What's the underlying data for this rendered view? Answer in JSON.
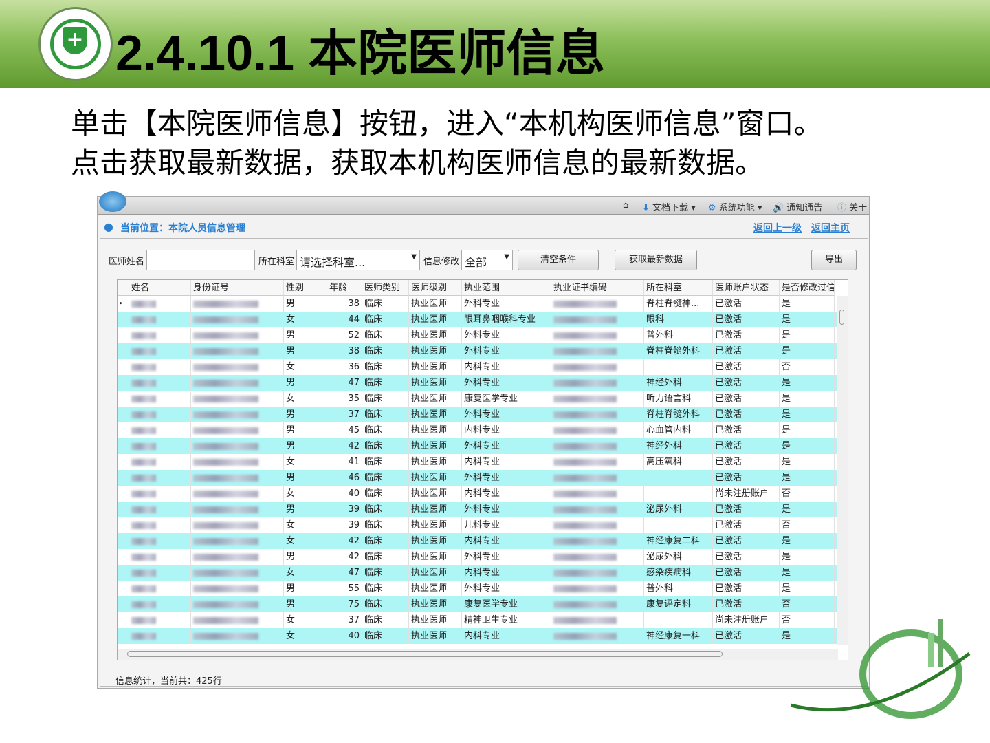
{
  "slide": {
    "title": "2.4.10.1  本院医师信息",
    "line1": "单击【本院医师信息】按钮，进入“本机构医师信息”窗口。",
    "line2": "点击获取最新数据，获取本机构医师信息的最新数据。"
  },
  "toolbar": {
    "download": "文档下载",
    "system": "系统功能",
    "notice": "通知通告",
    "about": "关于"
  },
  "location": {
    "text": "当前位置：本院人员信息管理",
    "back": "返回上一级",
    "home": "返回主页"
  },
  "filters": {
    "name_label": "医师姓名",
    "name_value": "",
    "dept_label": "所在科室",
    "dept_value": "请选择科室...",
    "mod_label": "信息修改",
    "mod_value": "全部",
    "clear": "清空条件",
    "fetch": "获取最新数据",
    "export": "导出"
  },
  "columns": [
    "姓名",
    "身份证号",
    "性别",
    "年龄",
    "医师类别",
    "医师级别",
    "执业范围",
    "执业证书编码",
    "所在科室",
    "医师账户状态",
    "是否修改过信息"
  ],
  "rows": [
    [
      "男",
      "38",
      "临床",
      "执业医师",
      "外科专业",
      "脊柱脊髓神...",
      "已激活",
      "是"
    ],
    [
      "女",
      "44",
      "临床",
      "执业医师",
      "眼耳鼻咽喉科专业",
      "眼科",
      "已激活",
      "是"
    ],
    [
      "男",
      "52",
      "临床",
      "执业医师",
      "外科专业",
      "普外科",
      "已激活",
      "是"
    ],
    [
      "男",
      "38",
      "临床",
      "执业医师",
      "外科专业",
      "脊柱脊髓外科",
      "已激活",
      "是"
    ],
    [
      "女",
      "36",
      "临床",
      "执业医师",
      "内科专业",
      "",
      "已激活",
      "否"
    ],
    [
      "男",
      "47",
      "临床",
      "执业医师",
      "外科专业",
      "神经外科",
      "已激活",
      "是"
    ],
    [
      "女",
      "35",
      "临床",
      "执业医师",
      "康复医学专业",
      "听力语言科",
      "已激活",
      "是"
    ],
    [
      "男",
      "37",
      "临床",
      "执业医师",
      "外科专业",
      "脊柱脊髓外科",
      "已激活",
      "是"
    ],
    [
      "男",
      "45",
      "临床",
      "执业医师",
      "内科专业",
      "心血管内科",
      "已激活",
      "是"
    ],
    [
      "男",
      "42",
      "临床",
      "执业医师",
      "外科专业",
      "神经外科",
      "已激活",
      "是"
    ],
    [
      "女",
      "41",
      "临床",
      "执业医师",
      "内科专业",
      "高压氧科",
      "已激活",
      "是"
    ],
    [
      "男",
      "46",
      "临床",
      "执业医师",
      "外科专业",
      "",
      "已激活",
      "是"
    ],
    [
      "女",
      "40",
      "临床",
      "执业医师",
      "内科专业",
      "",
      "尚未注册账户",
      "否"
    ],
    [
      "男",
      "39",
      "临床",
      "执业医师",
      "外科专业",
      "泌尿外科",
      "已激活",
      "是"
    ],
    [
      "女",
      "39",
      "临床",
      "执业医师",
      "儿科专业",
      "",
      "已激活",
      "否"
    ],
    [
      "女",
      "42",
      "临床",
      "执业医师",
      "内科专业",
      "神经康复二科",
      "已激活",
      "是"
    ],
    [
      "男",
      "42",
      "临床",
      "执业医师",
      "外科专业",
      "泌尿外科",
      "已激活",
      "是"
    ],
    [
      "女",
      "47",
      "临床",
      "执业医师",
      "内科专业",
      "感染疾病科",
      "已激活",
      "是"
    ],
    [
      "男",
      "55",
      "临床",
      "执业医师",
      "外科专业",
      "普外科",
      "已激活",
      "是"
    ],
    [
      "男",
      "75",
      "临床",
      "执业医师",
      "康复医学专业",
      "康复评定科",
      "已激活",
      "否"
    ],
    [
      "女",
      "37",
      "临床",
      "执业医师",
      "精神卫生专业",
      "",
      "尚未注册账户",
      "否"
    ],
    [
      "女",
      "40",
      "临床",
      "执业医师",
      "内科专业",
      "神经康复一科",
      "已激活",
      "是"
    ]
  ],
  "status": "信息统计，当前共：425行"
}
